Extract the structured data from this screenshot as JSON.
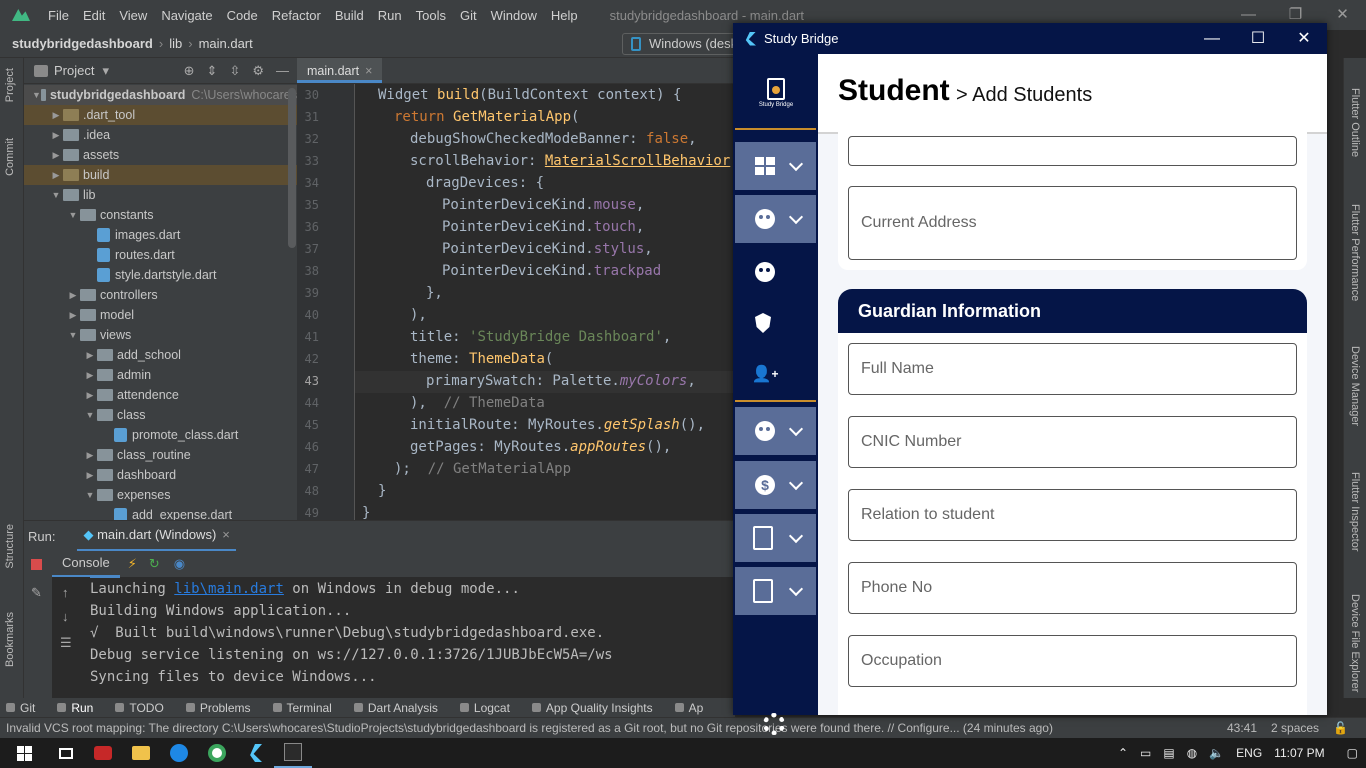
{
  "ide": {
    "menu": [
      "File",
      "Edit",
      "View",
      "Navigate",
      "Code",
      "Refactor",
      "Build",
      "Run",
      "Tools",
      "Git",
      "Window",
      "Help"
    ],
    "window_title": "studybridgedashboard - main.dart",
    "breadcrumb": {
      "project": "studybridgedashboard",
      "folder": "lib",
      "file": "main.dart"
    },
    "device_selector": "Windows (deskt",
    "left_tabs": [
      "Project",
      "Commit",
      "Structure",
      "Bookmarks"
    ],
    "right_tabs": [
      "Flutter Outline",
      "Flutter Performance",
      "Device Manager",
      "Flutter Inspector",
      "Device File Explorer"
    ],
    "project_panel": {
      "title": "Project",
      "tree": [
        {
          "name": "studybridgedashboard",
          "path": "C:\\Users\\whocares",
          "depth": 0,
          "kind": "folder",
          "open": true
        },
        {
          "name": ".dart_tool",
          "depth": 1,
          "kind": "folder-dark",
          "open": false
        },
        {
          "name": ".idea",
          "depth": 1,
          "kind": "folder",
          "open": false
        },
        {
          "name": "assets",
          "depth": 1,
          "kind": "folder",
          "open": false
        },
        {
          "name": "build",
          "depth": 1,
          "kind": "folder-dark",
          "open": false
        },
        {
          "name": "lib",
          "depth": 1,
          "kind": "folder",
          "open": true
        },
        {
          "name": "constants",
          "depth": 2,
          "kind": "folder",
          "open": true
        },
        {
          "name": "images.dart",
          "depth": 3,
          "kind": "file"
        },
        {
          "name": "routes.dart",
          "depth": 3,
          "kind": "file"
        },
        {
          "name": "style.dartstyle.dart",
          "depth": 3,
          "kind": "file"
        },
        {
          "name": "controllers",
          "depth": 2,
          "kind": "folder",
          "open": false
        },
        {
          "name": "model",
          "depth": 2,
          "kind": "folder",
          "open": false
        },
        {
          "name": "views",
          "depth": 2,
          "kind": "folder",
          "open": true
        },
        {
          "name": "add_school",
          "depth": 3,
          "kind": "folder",
          "open": false
        },
        {
          "name": "admin",
          "depth": 3,
          "kind": "folder",
          "open": false
        },
        {
          "name": "attendence",
          "depth": 3,
          "kind": "folder",
          "open": false
        },
        {
          "name": "class",
          "depth": 3,
          "kind": "folder",
          "open": true
        },
        {
          "name": "promote_class.dart",
          "depth": 4,
          "kind": "file"
        },
        {
          "name": "class_routine",
          "depth": 3,
          "kind": "folder",
          "open": false
        },
        {
          "name": "dashboard",
          "depth": 3,
          "kind": "folder",
          "open": false
        },
        {
          "name": "expenses",
          "depth": 3,
          "kind": "folder",
          "open": true
        },
        {
          "name": "add_expense.dart",
          "depth": 4,
          "kind": "file"
        }
      ]
    },
    "editor": {
      "tab": "main.dart",
      "line_numbers": [
        "30",
        "31",
        "32",
        "33",
        "34",
        "35",
        "36",
        "37",
        "38",
        "39",
        "40",
        "41",
        "42",
        "43",
        "44",
        "45",
        "46",
        "47",
        "48",
        "49"
      ]
    },
    "run_panel": {
      "label": "Run:",
      "tab": "main.dart (Windows)",
      "console_tab": "Console",
      "lines": [
        {
          "pre": "Launching ",
          "link": "lib\\main.dart",
          "post": " on Windows in debug mode..."
        },
        {
          "pre": "Building Windows application...",
          "link": "",
          "post": ""
        },
        {
          "pre": "√  Built build\\windows\\runner\\Debug\\studybridgedashboard.exe.",
          "link": "",
          "post": ""
        },
        {
          "pre": "Debug service listening on ws://127.0.0.1:3726/1JUBJbEcW5A=/ws",
          "link": "",
          "post": ""
        },
        {
          "pre": "Syncing files to device Windows...",
          "link": "",
          "post": ""
        }
      ]
    },
    "bottom_tabs": [
      "Git",
      "Run",
      "TODO",
      "Problems",
      "Terminal",
      "Dart Analysis",
      "Logcat",
      "App Quality Insights",
      "Ap"
    ],
    "status": {
      "message": "Invalid VCS root mapping: The directory C:\\Users\\whocares\\StudioProjects\\studybridgedashboard is registered as a Git root, but no Git repositories were found there. // Configure... (24 minutes ago)",
      "position": "43:41",
      "indent": "2 spaces"
    }
  },
  "taskbar": {
    "language": "ENG",
    "time": "11:07 PM"
  },
  "app": {
    "title": "Study Bridge",
    "logo_text": "Study Bridge",
    "header_title": "Student",
    "header_subtitle": "> Add Students",
    "fields_top": [
      "",
      "Current Address"
    ],
    "guardian_title": "Guardian Information",
    "guardian_fields": [
      "Full Name",
      "CNIC Number",
      "Relation to student",
      "Phone No",
      "Occupation"
    ],
    "sidebar_icons": [
      "dashboard-icon",
      "student-icon",
      "student-icon",
      "shield-icon",
      "add-user-icon",
      "student-icon",
      "dollar-icon",
      "document-icon",
      "document-icon",
      "gear-icon"
    ],
    "colors": {
      "sidebar": "#051547",
      "expanded_item": "#5a6d98",
      "divider": "#c98d2c"
    }
  }
}
